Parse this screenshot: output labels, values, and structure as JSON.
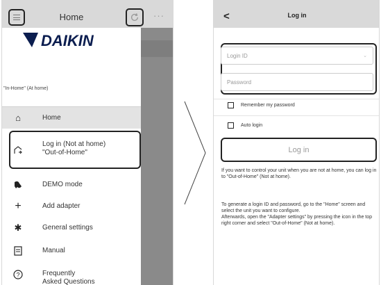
{
  "left_screen": {
    "title": "Home",
    "menu_icon": "hamburger-menu-icon",
    "refresh_icon": "refresh-icon",
    "more_icon": "more-dots-icon",
    "more_text": "···",
    "brand": "DAIKIN",
    "location_label": "\"In-Home\" (At home)",
    "menu_items": [
      {
        "label": "Home",
        "icon": "house-icon",
        "glyph": "⌂"
      },
      {
        "label_line1": "Log in (Not at home)",
        "label_line2": "\"Out-of-Home\"",
        "icon": "login-icon",
        "glyph": "🏠"
      },
      {
        "label": "DEMO mode",
        "icon": "demo-icon",
        "glyph": "✦"
      },
      {
        "label": "Add adapter",
        "icon": "plus-icon",
        "glyph": "+"
      },
      {
        "label": "General settings",
        "icon": "gear-icon",
        "glyph": "✱"
      },
      {
        "label": "Manual",
        "icon": "manual-icon",
        "glyph": "▤"
      },
      {
        "label_line1": "Frequently",
        "label_line2": "Asked Questions",
        "icon": "question-icon",
        "glyph": "?"
      }
    ]
  },
  "right_screen": {
    "title": "Log in",
    "back_glyph": "<",
    "login_id_placeholder": "Login ID",
    "password_placeholder": "Password",
    "remember_label": "Remember my password",
    "auto_login_label": "Auto login",
    "login_button": "Log in",
    "info_1": "If you want to control your unit when you are not at home, you can log in to \"Out-of-Home\" (Not at home).",
    "info_2a": "To generate a login ID and password, go to the \"Home\" screen and select the unit you want to configure.",
    "info_2b": "Afterwards, open the \"Adapter settings\" by pressing the icon in the top right corner and select \"Out-of-Home\" (Not at home)."
  },
  "colors": {
    "topbar": "#d9d9d9",
    "overlay": "#8a8a8a",
    "highlight_border": "#222222",
    "brand_blue": "#0b1d4f"
  }
}
